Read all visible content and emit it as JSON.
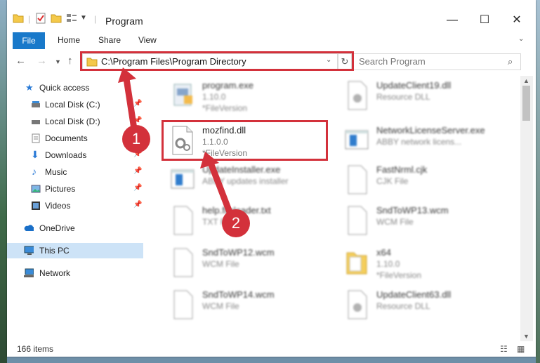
{
  "window": {
    "title": "Program"
  },
  "ribbon": {
    "tabs": [
      "File",
      "Home",
      "Share",
      "View"
    ]
  },
  "nav": {
    "address": "C:\\Program Files\\Program Directory",
    "search_placeholder": "Search Program"
  },
  "sidebar": {
    "items": [
      {
        "label": "Quick access",
        "icon": "star-icon"
      },
      {
        "label": "Local Disk (C:)",
        "icon": "drive-icon"
      },
      {
        "label": "Local Disk (D:)",
        "icon": "drive-icon"
      },
      {
        "label": "Documents",
        "icon": "documents-icon"
      },
      {
        "label": "Downloads",
        "icon": "download-icon"
      },
      {
        "label": "Music",
        "icon": "music-icon"
      },
      {
        "label": "Pictures",
        "icon": "pictures-icon"
      },
      {
        "label": "Videos",
        "icon": "videos-icon"
      },
      {
        "label": "OneDrive",
        "icon": "cloud-icon"
      },
      {
        "label": "This PC",
        "icon": "computer-icon"
      },
      {
        "label": "Network",
        "icon": "network-icon"
      }
    ]
  },
  "files": [
    {
      "name": "program.exe",
      "line1": "1.10.0",
      "line2": "*FileVersion",
      "icon": "exe-icon"
    },
    {
      "name": "UpdateClient19.dll",
      "line1": "Resource DLL",
      "line2": "",
      "icon": "dll-icon"
    },
    {
      "name": "mozfind.dll",
      "line1": "1.1.0.0",
      "line2": "*FileVersion",
      "icon": "dll-gear-icon"
    },
    {
      "name": "NetworkLicenseServer.exe",
      "line1": "ABBY network licens...",
      "line2": "",
      "icon": "exe-window-icon"
    },
    {
      "name": "UpdateInstaller.exe",
      "line1": "ABBY updates installer",
      "line2": "",
      "icon": "exe-window-icon"
    },
    {
      "name": "FastNrml.cjk",
      "line1": "CJK File",
      "line2": "",
      "icon": "file-icon"
    },
    {
      "name": "help.fileloader.txt",
      "line1": "TXT File",
      "line2": "",
      "icon": "file-icon"
    },
    {
      "name": "SndToWP13.wcm",
      "line1": "WCM File",
      "line2": "",
      "icon": "file-icon"
    },
    {
      "name": "SndToWP12.wcm",
      "line1": "WCM File",
      "line2": "",
      "icon": "file-icon"
    },
    {
      "name": "x64",
      "line1": "1.10.0",
      "line2": "*FileVersion",
      "icon": "folder-icon"
    },
    {
      "name": "SndToWP14.wcm",
      "line1": "WCM File",
      "line2": "",
      "icon": "file-icon"
    },
    {
      "name": "UpdateClient63.dll",
      "line1": "Resource DLL",
      "line2": "",
      "icon": "dll-icon"
    }
  ],
  "status": {
    "items": "166 items"
  },
  "annotations": {
    "step1": "1",
    "step2": "2"
  },
  "colors": {
    "accent": "#1979ca",
    "highlight": "#d3313b",
    "selection": "#cde3f7"
  }
}
